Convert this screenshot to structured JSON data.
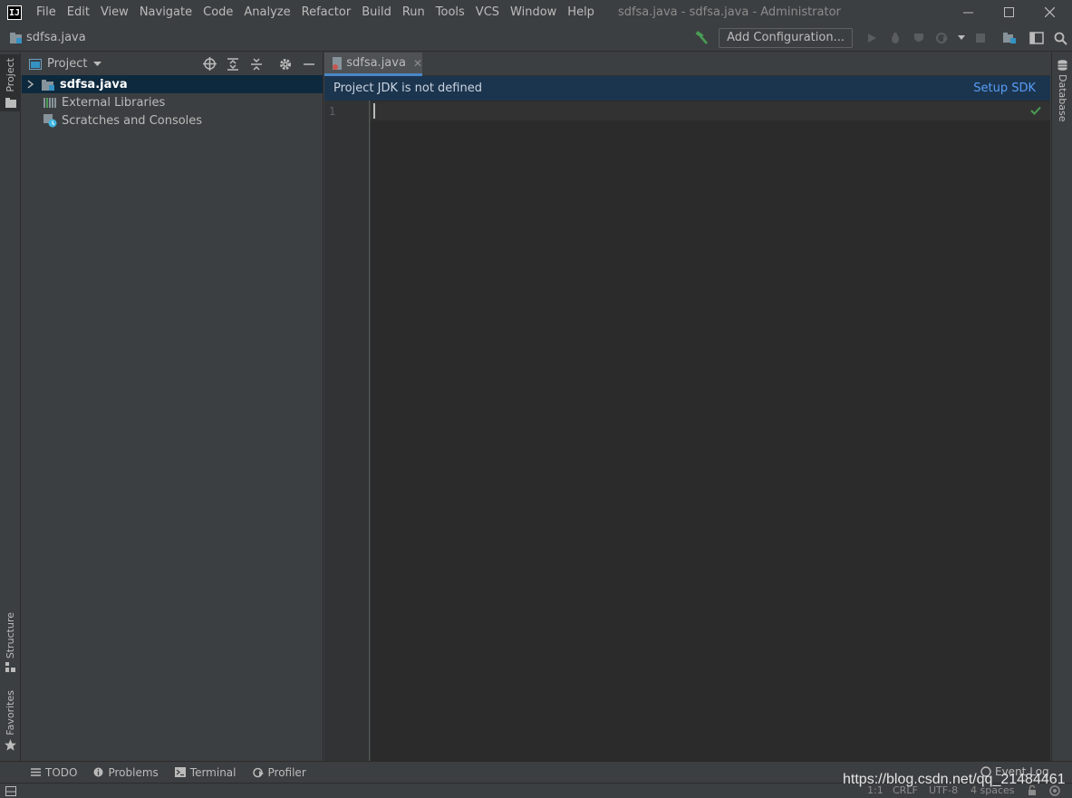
{
  "app": {
    "logo_text": "IJ"
  },
  "menu": [
    "File",
    "Edit",
    "View",
    "Navigate",
    "Code",
    "Analyze",
    "Refactor",
    "Build",
    "Run",
    "Tools",
    "VCS",
    "Window",
    "Help"
  ],
  "window_title": "sdfsa.java - sdfsa.java - Administrator",
  "navbar": {
    "breadcrumb": "sdfsa.java",
    "add_configuration": "Add Configuration..."
  },
  "left_tools": {
    "project": "Project",
    "structure": "Structure",
    "favorites": "Favorites"
  },
  "right_tools": {
    "database": "Database"
  },
  "project_panel": {
    "title": "Project",
    "tree": [
      {
        "label": "sdfsa.java",
        "selected": true
      },
      {
        "label": "External Libraries"
      },
      {
        "label": "Scratches and Consoles"
      }
    ]
  },
  "editor": {
    "tab_label": "sdfsa.java",
    "banner_message": "Project JDK is not defined",
    "banner_action": "Setup SDK",
    "line_number": "1"
  },
  "bottom_tools": [
    {
      "label": "TODO"
    },
    {
      "label": "Problems"
    },
    {
      "label": "Terminal"
    },
    {
      "label": "Profiler"
    }
  ],
  "event_log": "Event Log",
  "status": {
    "position": "1:1",
    "line_separator": "CRLF",
    "encoding": "UTF-8",
    "indent": "4 spaces"
  },
  "watermark": "https://blog.csdn.net/qq_21484461",
  "colors": {
    "accent": "#4a88c7",
    "banner_bg": "#1c354e",
    "link": "#589df6",
    "editor_bg": "#2b2b2b",
    "panel_bg": "#3c3f41",
    "build_green": "#499c54"
  }
}
